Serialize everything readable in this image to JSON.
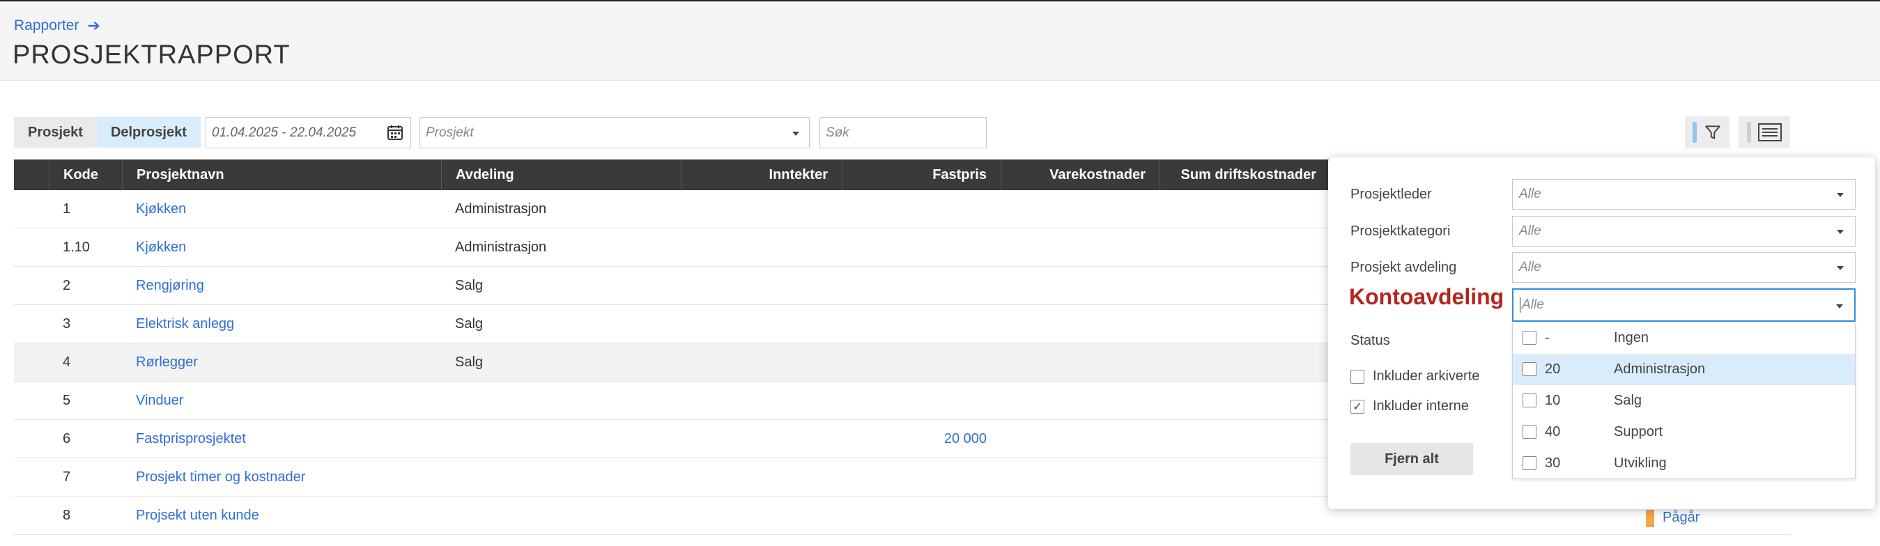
{
  "breadcrumb": {
    "label": "Rapporter"
  },
  "page": {
    "title": "PROSJEKTRAPPORT"
  },
  "toolbar": {
    "tabs": [
      {
        "label": "Prosjekt",
        "active": false
      },
      {
        "label": "Delprosjekt",
        "active": true
      }
    ],
    "date_range": "01.04.2025 - 22.04.2025",
    "project_placeholder": "Prosjekt",
    "search_placeholder": "Søk"
  },
  "table": {
    "headers": {
      "code": "Kode",
      "name": "Prosjektnavn",
      "dept": "Avdeling",
      "income": "Inntekter",
      "fixed": "Fastpris",
      "goods": "Varekostnader",
      "opex": "Sum driftskostnader"
    },
    "rows": [
      {
        "code": "1",
        "name": "Kjøkken",
        "dept": "Administrasjon",
        "fixed": ""
      },
      {
        "code": "1.10",
        "name": "Kjøkken",
        "dept": "Administrasjon",
        "fixed": ""
      },
      {
        "code": "2",
        "name": "Rengjøring",
        "dept": "Salg",
        "fixed": ""
      },
      {
        "code": "3",
        "name": "Elektrisk anlegg",
        "dept": "Salg",
        "fixed": ""
      },
      {
        "code": "4",
        "name": "Rørlegger",
        "dept": "Salg",
        "fixed": ""
      },
      {
        "code": "5",
        "name": "Vinduer",
        "dept": "",
        "fixed": ""
      },
      {
        "code": "6",
        "name": "Fastprisprosjektet",
        "dept": "",
        "fixed": "20 000"
      },
      {
        "code": "7",
        "name": "Prosjekt timer og kostnader",
        "dept": "",
        "fixed": ""
      },
      {
        "code": "8",
        "name": "Projsekt uten kunde",
        "dept": "",
        "fixed": ""
      }
    ],
    "last_row_status": "Pågår"
  },
  "filter_panel": {
    "project_leader": {
      "label": "Prosjektleder",
      "value": "Alle"
    },
    "project_category": {
      "label": "Prosjektkategori",
      "value": "Alle"
    },
    "project_department": {
      "label": "Prosjekt avdeling",
      "value": "Alle"
    },
    "account_department": {
      "label": "Kontoavdeling",
      "value": "Alle"
    },
    "status_label": "Status",
    "include_archived": {
      "label": "Inkluder arkiverte",
      "checked": false
    },
    "include_internal": {
      "label": "Inkluder interne",
      "checked": true
    },
    "clear_label": "Fjern alt",
    "options": [
      {
        "num": "-",
        "name": "Ingen",
        "checked": false
      },
      {
        "num": "20",
        "name": "Administrasjon",
        "checked": false
      },
      {
        "num": "10",
        "name": "Salg",
        "checked": false
      },
      {
        "num": "40",
        "name": "Support",
        "checked": false
      },
      {
        "num": "30",
        "name": "Utvikling",
        "checked": false
      }
    ]
  },
  "colors": {
    "link": "#2f6fd6",
    "header_bg": "#3a3a3a",
    "highlight": "#d9ecfb",
    "kontoavdeling": "#b3261e",
    "status_bar": "#f0a84a"
  }
}
